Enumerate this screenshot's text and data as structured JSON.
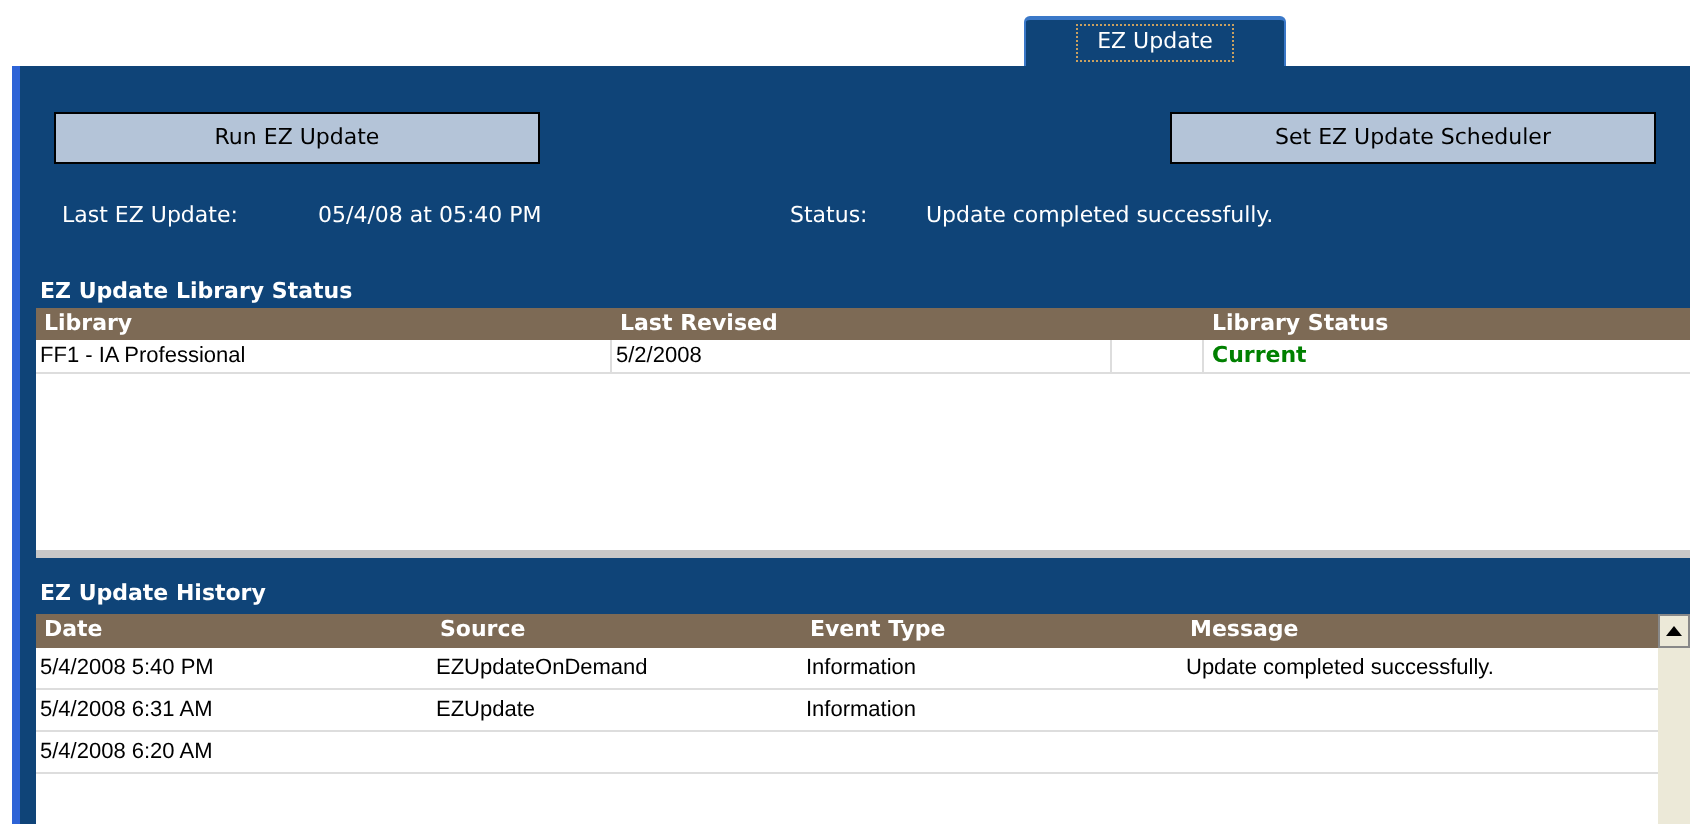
{
  "tabs": [
    {
      "label": "EZ Update",
      "selected": true
    }
  ],
  "buttons": [
    {
      "label": "Run EZ Update"
    },
    {
      "label": "Set EZ Update Scheduler"
    }
  ],
  "last_update": {
    "label": "Last EZ Update:",
    "value": "05/4/08 at 05:40 PM"
  },
  "status": {
    "label": "Status:",
    "value": "Update completed successfully."
  },
  "library_status": {
    "title": "EZ Update Library Status",
    "columns": [
      "Library",
      "Last Revised",
      "",
      "Library Status"
    ],
    "rows": [
      {
        "library": "FF1 - IA Professional",
        "last_revised": "5/2/2008",
        "status": "Current"
      }
    ]
  },
  "history": {
    "title": "EZ Update History",
    "columns": [
      "Date",
      "Source",
      "Event Type",
      "Message"
    ],
    "rows": [
      {
        "date": "5/4/2008 5:40 PM",
        "source": "EZUpdateOnDemand",
        "event_type": "Information",
        "message": "Update completed successfully."
      },
      {
        "date": "5/4/2008 6:31 AM",
        "source": "EZUpdate",
        "event_type": "Information"
      },
      {
        "date": "5/4/2008 6:20 AM"
      }
    ]
  }
}
